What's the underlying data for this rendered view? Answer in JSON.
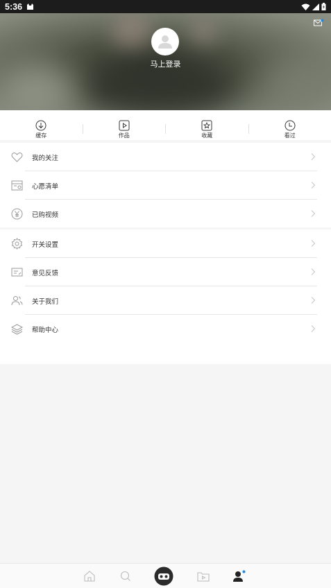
{
  "status_bar": {
    "time": "5:36"
  },
  "header": {
    "login_label": "马上登录"
  },
  "quick_actions": [
    {
      "label": "缓存",
      "icon": "download-icon"
    },
    {
      "label": "作品",
      "icon": "play-icon"
    },
    {
      "label": "收藏",
      "icon": "star-icon"
    },
    {
      "label": "看过",
      "icon": "history-icon"
    }
  ],
  "menu_group_1": [
    {
      "label": "我的关注",
      "icon": "heart-icon"
    },
    {
      "label": "心愿清单",
      "icon": "wishlist-icon"
    },
    {
      "label": "已购视频",
      "icon": "yuan-icon"
    }
  ],
  "menu_group_2": [
    {
      "label": "开关设置",
      "icon": "gear-icon"
    },
    {
      "label": "意见反馈",
      "icon": "feedback-icon"
    },
    {
      "label": "关于我们",
      "icon": "users-icon"
    },
    {
      "label": "帮助中心",
      "icon": "layers-icon"
    }
  ],
  "bottom_nav": [
    {
      "name": "home",
      "icon": "home-icon"
    },
    {
      "name": "search",
      "icon": "search-icon"
    },
    {
      "name": "center",
      "icon": "vr-glasses-icon"
    },
    {
      "name": "video",
      "icon": "video-folder-icon"
    },
    {
      "name": "profile",
      "icon": "person-icon"
    }
  ],
  "colors": {
    "accent_dot": "#1e88e5",
    "icon_gray": "#999999",
    "active_icon": "#222222"
  }
}
